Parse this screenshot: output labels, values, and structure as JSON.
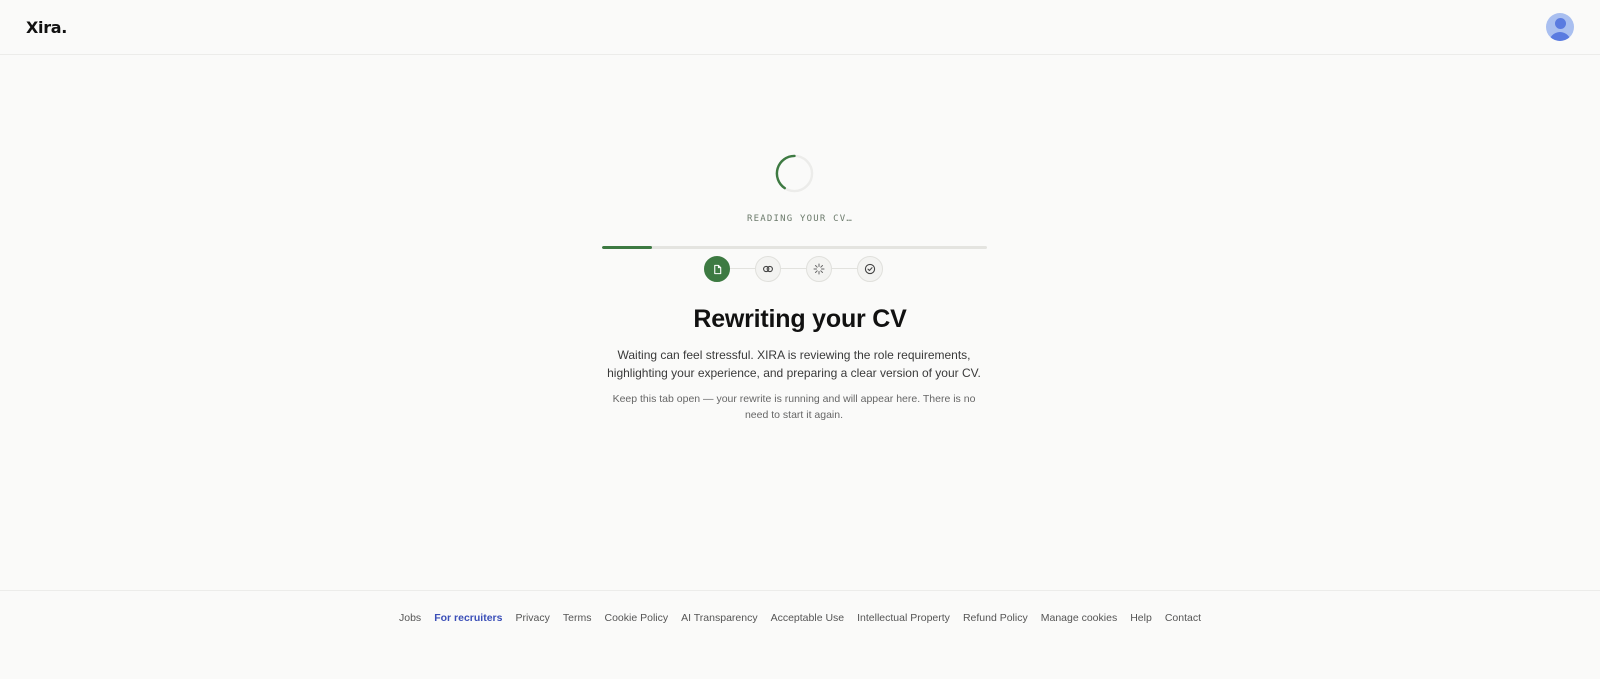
{
  "header": {
    "logo": "Xira."
  },
  "loader": {
    "status": "READING YOUR CV…",
    "progress": 0.13,
    "steps": [
      {
        "icon": "document-icon",
        "state": "active"
      },
      {
        "icon": "link-icon",
        "state": "pending"
      },
      {
        "icon": "sparkle-icon",
        "state": "pending"
      },
      {
        "icon": "check-circle-icon",
        "state": "pending"
      }
    ],
    "accent_color": "#3d7a42"
  },
  "content": {
    "title": "Rewriting your CV",
    "description": "Waiting can feel stressful. XIRA is reviewing the role requirements, highlighting your experience, and preparing a clear version of your CV.",
    "note": "Keep this tab open — your rewrite is running and will appear here. There is no need to start it again."
  },
  "footer": {
    "links": [
      {
        "label": "Jobs"
      },
      {
        "label": "For recruiters",
        "highlight": true
      },
      {
        "label": "Privacy"
      },
      {
        "label": "Terms"
      },
      {
        "label": "Cookie Policy"
      },
      {
        "label": "AI Transparency"
      },
      {
        "label": "Acceptable Use"
      },
      {
        "label": "Intellectual Property"
      },
      {
        "label": "Refund Policy"
      },
      {
        "label": "Manage cookies"
      },
      {
        "label": "Help"
      },
      {
        "label": "Contact"
      }
    ]
  }
}
